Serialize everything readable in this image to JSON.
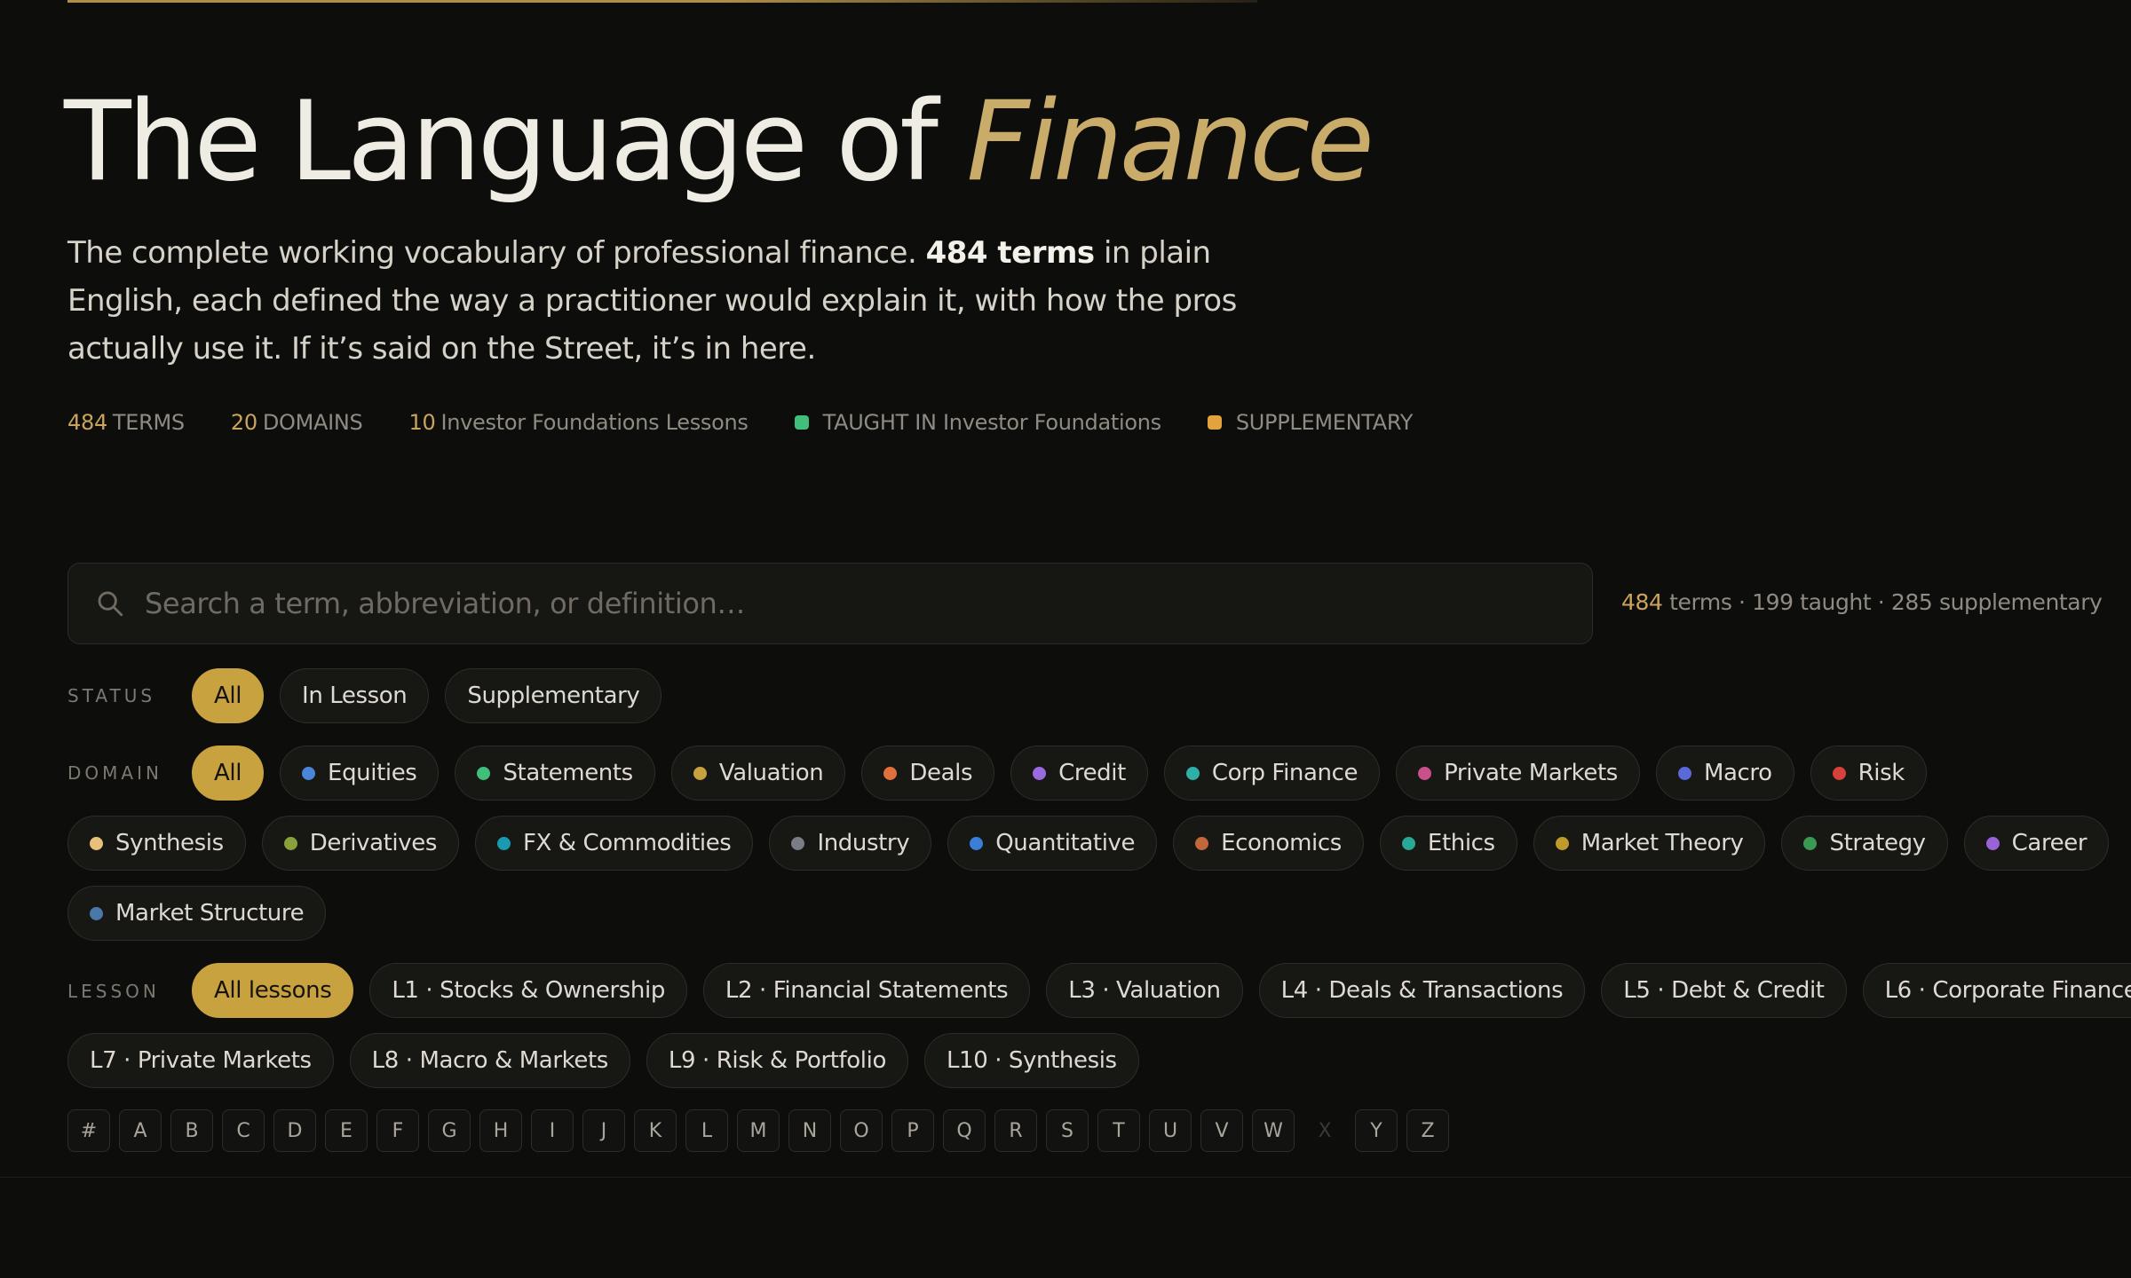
{
  "hero": {
    "title_main": "The Language of ",
    "title_accent": "Finance",
    "intro_a": "The complete working vocabulary of professional finance. ",
    "intro_bold": "484 terms",
    "intro_b": " in plain English, each defined the way a practitioner would explain it, with how the pros actually use it. If it’s said on the Street, it’s in here."
  },
  "meta": {
    "terms_num": "484",
    "terms_label": "TERMS",
    "domains_num": "20",
    "domains_label": "DOMAINS",
    "lessons_num": "10",
    "lessons_label": "Investor Foundations Lessons",
    "taught_label": "TAUGHT IN Investor Foundations",
    "supp_label": "SUPPLEMENTARY",
    "taught_color": "#3fbf7a",
    "supp_color": "#e4a23c"
  },
  "search": {
    "placeholder": "Search a term, abbreviation, or definition…",
    "value": "",
    "count_num": "484",
    "count_rest": " terms · 199 taught · 285 supplementary"
  },
  "filters": {
    "status_label": "STATUS",
    "status": [
      "All",
      "In Lesson",
      "Supplementary"
    ],
    "domain_label": "DOMAIN",
    "domain_all": "All",
    "domains": [
      {
        "name": "Equities",
        "color": "#4a86d8"
      },
      {
        "name": "Statements",
        "color": "#3fbf7a"
      },
      {
        "name": "Valuation",
        "color": "#c9a240"
      },
      {
        "name": "Deals",
        "color": "#e0703c"
      },
      {
        "name": "Credit",
        "color": "#9a6ae0"
      },
      {
        "name": "Corp Finance",
        "color": "#2fb0a6"
      },
      {
        "name": "Private Markets",
        "color": "#c9508a"
      },
      {
        "name": "Macro",
        "color": "#5a6ad8"
      },
      {
        "name": "Risk",
        "color": "#d8403c"
      },
      {
        "name": "Synthesis",
        "color": "#e8c07a"
      },
      {
        "name": "Derivatives",
        "color": "#8aa03a"
      },
      {
        "name": "FX & Commodities",
        "color": "#1a9ab0"
      },
      {
        "name": "Industry",
        "color": "#7a7d86"
      },
      {
        "name": "Quantitative",
        "color": "#3a7ed8"
      },
      {
        "name": "Economics",
        "color": "#c0683c"
      },
      {
        "name": "Ethics",
        "color": "#2aa896"
      },
      {
        "name": "Market Theory",
        "color": "#c09a2a"
      },
      {
        "name": "Strategy",
        "color": "#3a9a52"
      },
      {
        "name": "Career",
        "color": "#9a62d8"
      },
      {
        "name": "Market Structure",
        "color": "#4a78a8"
      }
    ],
    "lesson_label": "LESSON",
    "lessons": [
      "All lessons",
      "L1 · Stocks & Ownership",
      "L2 · Financial Statements",
      "L3 · Valuation",
      "L4 · Deals & Transactions",
      "L5 · Debt & Credit",
      "L6 · Corporate Finance",
      "L7 · Private Markets",
      "L8 · Macro & Markets",
      "L9 · Risk & Portfolio",
      "L10 · Synthesis"
    ]
  },
  "alphabet": [
    "#",
    "A",
    "B",
    "C",
    "D",
    "E",
    "F",
    "G",
    "H",
    "I",
    "J",
    "K",
    "L",
    "M",
    "N",
    "O",
    "P",
    "Q",
    "R",
    "S",
    "T",
    "U",
    "V",
    "W",
    "X",
    "Y",
    "Z"
  ],
  "alphabet_disabled": [
    "X"
  ],
  "colors": {
    "accent": "#c9a240",
    "background": "#0d0d0c"
  }
}
